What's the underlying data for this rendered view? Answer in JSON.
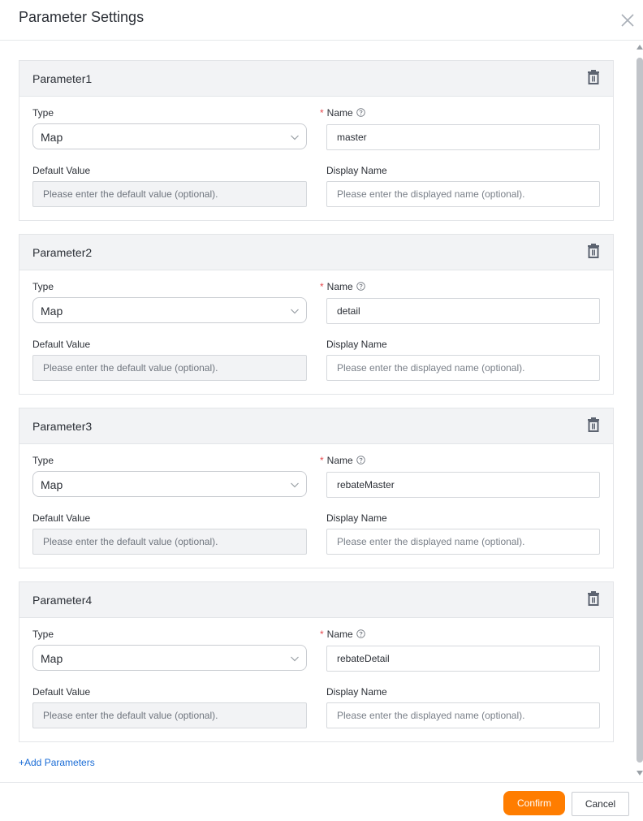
{
  "dialog": {
    "title": "Parameter Settings",
    "close_icon": "close-icon"
  },
  "labels": {
    "type": "Type",
    "name": "Name",
    "required_mark": "*",
    "default_value": "Default Value",
    "display_name": "Display Name"
  },
  "placeholders": {
    "default_value": "Please enter the default value (optional).",
    "display_name": "Please enter the displayed name (optional)."
  },
  "parameters": [
    {
      "title": "Parameter1",
      "type": "Map",
      "name": "master"
    },
    {
      "title": "Parameter2",
      "type": "Map",
      "name": "detail"
    },
    {
      "title": "Parameter3",
      "type": "Map",
      "name": "rebateMaster"
    },
    {
      "title": "Parameter4",
      "type": "Map",
      "name": "rebateDetail"
    }
  ],
  "add_link": "+Add Parameters",
  "footer": {
    "confirm_label": "Confirm",
    "cancel_label": "Cancel"
  },
  "colors": {
    "accent": "#ff7d00",
    "link": "#1a6cd6",
    "required": "#e5484d",
    "card_header_bg": "#f2f3f5"
  },
  "icons": {
    "delete": "trash-icon",
    "help": "question-circle-icon",
    "dropdown": "chevron-down-icon"
  }
}
